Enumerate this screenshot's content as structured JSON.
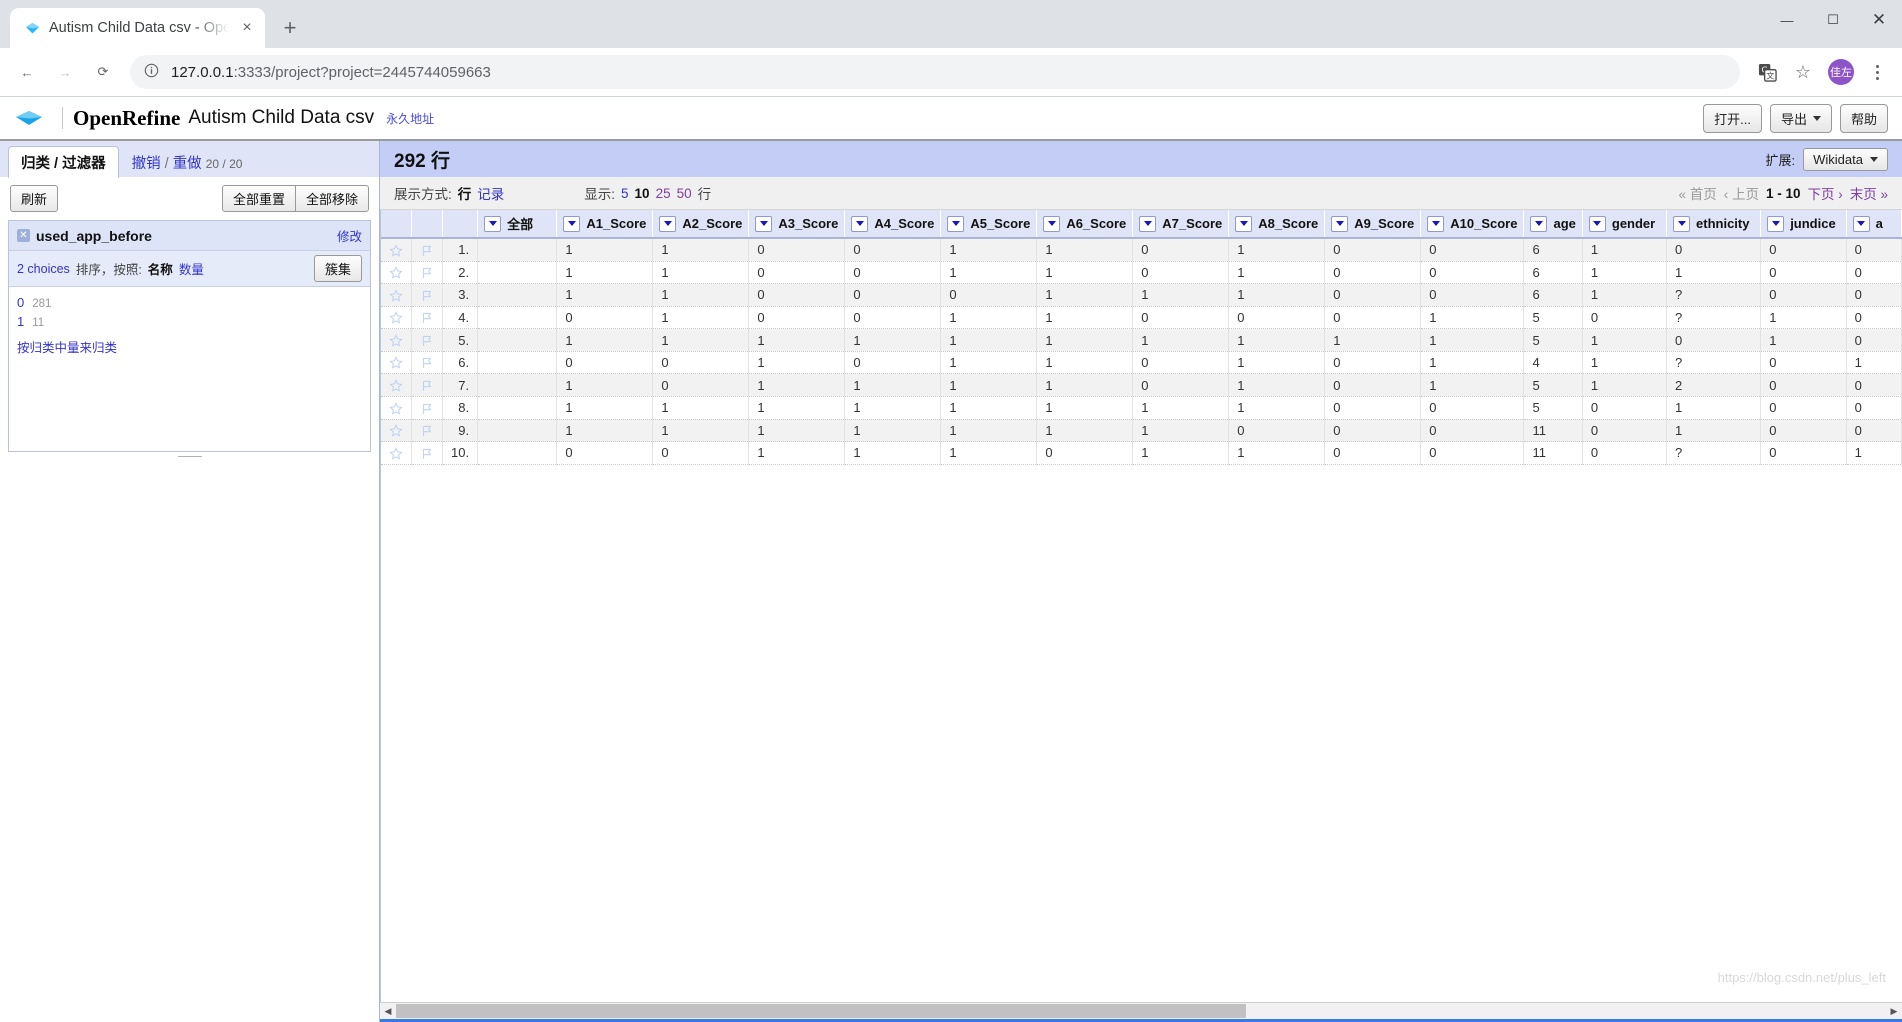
{
  "browser": {
    "tab": {
      "title": "Autism Child Data csv - OpenR",
      "favicon": "diamond-icon",
      "close": "×"
    },
    "new_tab": "+",
    "window_controls": {
      "minimize": "—",
      "maximize": "☐",
      "close": "✕"
    },
    "nav": {
      "back": "←",
      "forward": "→",
      "reload": "⟳"
    },
    "omnibox": {
      "info_icon": "info-circle-icon",
      "url_main": "127.0.0.1",
      "url_rest": ":3333/project?project=2445744059663"
    },
    "toolbar_right": {
      "translate": "translate-icon",
      "bookmark": "☆",
      "avatar": "佳左",
      "menu": "kebab-menu-icon"
    }
  },
  "openrefine": {
    "brand": "OpenRefine",
    "project_name": "Autism Child Data csv",
    "permalink": "永久地址",
    "buttons": {
      "open": "打开...",
      "export": "导出",
      "help": "帮助"
    }
  },
  "left_panel": {
    "tabs": [
      {
        "label": "归类 / 过滤器",
        "active": true
      },
      {
        "label_a": "撤销",
        "sep": "/",
        "label_b": "重做",
        "count": "20 / 20",
        "active": false
      }
    ],
    "toolbar": {
      "refresh": "刷新",
      "reset_all": "全部重置",
      "remove_all": "全部移除"
    },
    "facet": {
      "name": "used_app_before",
      "close": "✕",
      "edit": "修改",
      "choices_label": "2 choices",
      "sort_label": "排序，按照:",
      "sort_by_name": "名称",
      "sort_by_count": "数量",
      "cluster": "簇集",
      "choices": [
        {
          "label": "0",
          "count": "281"
        },
        {
          "label": "1",
          "count": "11"
        }
      ],
      "group_link": "按归类中量来归类"
    }
  },
  "main": {
    "rows_count": "292 行",
    "extend_label": "扩展:",
    "extend_value": "Wikidata",
    "show_as_label": "展示方式:",
    "show_as_rows": "行",
    "show_as_records": "记录",
    "display_label": "显示:",
    "page_sizes": [
      "5",
      "10",
      "25",
      "50"
    ],
    "page_size_active": "10",
    "page_sizes_suffix": "行",
    "pager": {
      "first": "« 首页",
      "prev": "‹ 上页",
      "range": "1 - 10",
      "next": "下页 ›",
      "last": "末页 »"
    },
    "columns": [
      "全部",
      "A1_Score",
      "A2_Score",
      "A3_Score",
      "A4_Score",
      "A5_Score",
      "A6_Score",
      "A7_Score",
      "A8_Score",
      "A9_Score",
      "A10_Score",
      "age",
      "gender",
      "ethnicity",
      "jundice",
      "a"
    ],
    "rows": [
      {
        "index": "1.",
        "cells": [
          "",
          "1",
          "1",
          "0",
          "0",
          "1",
          "1",
          "0",
          "1",
          "0",
          "0",
          "6",
          "1",
          "0",
          "0",
          "0"
        ]
      },
      {
        "index": "2.",
        "cells": [
          "",
          "1",
          "1",
          "0",
          "0",
          "1",
          "1",
          "0",
          "1",
          "0",
          "0",
          "6",
          "1",
          "1",
          "0",
          "0"
        ]
      },
      {
        "index": "3.",
        "cells": [
          "",
          "1",
          "1",
          "0",
          "0",
          "0",
          "1",
          "1",
          "1",
          "0",
          "0",
          "6",
          "1",
          "?",
          "0",
          "0"
        ]
      },
      {
        "index": "4.",
        "cells": [
          "",
          "0",
          "1",
          "0",
          "0",
          "1",
          "1",
          "0",
          "0",
          "0",
          "1",
          "5",
          "0",
          "?",
          "1",
          "0"
        ]
      },
      {
        "index": "5.",
        "cells": [
          "",
          "1",
          "1",
          "1",
          "1",
          "1",
          "1",
          "1",
          "1",
          "1",
          "1",
          "5",
          "1",
          "0",
          "1",
          "0"
        ]
      },
      {
        "index": "6.",
        "cells": [
          "",
          "0",
          "0",
          "1",
          "0",
          "1",
          "1",
          "0",
          "1",
          "0",
          "1",
          "4",
          "1",
          "?",
          "0",
          "1"
        ]
      },
      {
        "index": "7.",
        "cells": [
          "",
          "1",
          "0",
          "1",
          "1",
          "1",
          "1",
          "0",
          "1",
          "0",
          "1",
          "5",
          "1",
          "2",
          "0",
          "0"
        ]
      },
      {
        "index": "8.",
        "cells": [
          "",
          "1",
          "1",
          "1",
          "1",
          "1",
          "1",
          "1",
          "1",
          "0",
          "0",
          "5",
          "0",
          "1",
          "0",
          "0"
        ]
      },
      {
        "index": "9.",
        "cells": [
          "",
          "1",
          "1",
          "1",
          "1",
          "1",
          "1",
          "1",
          "0",
          "0",
          "0",
          "11",
          "0",
          "1",
          "0",
          "0"
        ]
      },
      {
        "index": "10.",
        "cells": [
          "",
          "0",
          "0",
          "1",
          "1",
          "1",
          "0",
          "1",
          "1",
          "0",
          "0",
          "11",
          "0",
          "?",
          "0",
          "1"
        ]
      }
    ]
  },
  "watermark": "https://blog.csdn.net/plus_left"
}
